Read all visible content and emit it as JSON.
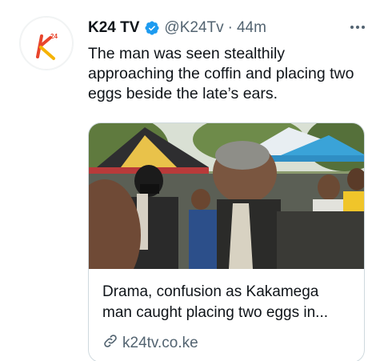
{
  "tweet": {
    "author_name": "K24 TV",
    "handle": "@K24Tv",
    "separator": "·",
    "time": "44m",
    "avatar_logo_text": "K24",
    "text": "The man was seen stealthily approaching the coffin and placing two eggs beside the late’s ears.",
    "card": {
      "title_line1": "Drama, confusion as Kakamega",
      "title_line2": "man caught placing two eggs in...",
      "domain": "k24tv.co.ke"
    }
  },
  "icons": {
    "verified": "verified-badge-icon",
    "more": "more-options-icon",
    "link": "link-icon"
  },
  "colors": {
    "verified_blue": "#1d9bf0",
    "brand_orange": "#e8452c",
    "brand_yellow": "#f5b301",
    "text_primary": "#0f1419",
    "text_secondary": "#536471"
  }
}
